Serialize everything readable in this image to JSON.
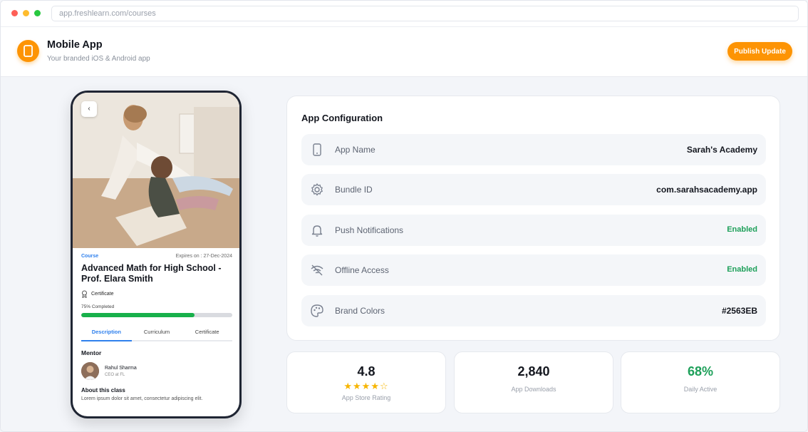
{
  "browser": {
    "url": "app.freshlearn.com/courses"
  },
  "header": {
    "title": "Mobile App",
    "subtitle": "Your branded iOS & Android app",
    "publish_label": "Publish Update"
  },
  "phone": {
    "course_tag": "Course",
    "expires": "Expires on : 27-Dec-2024",
    "course_title": "Advanced Math for High School - Prof. Elara Smith",
    "certificate_label": "Certificate",
    "progress_label": "75% Completed",
    "progress_fraction": 0.75,
    "tabs": [
      {
        "label": "Description",
        "active": true
      },
      {
        "label": "Curriculum",
        "active": false
      },
      {
        "label": "Certificate",
        "active": false
      }
    ],
    "mentor_heading": "Mentor",
    "mentor_name": "Rahul Sharma",
    "mentor_role": "CEO at FL",
    "about_heading": "About this class",
    "about_text": "Lorem ipsum dolor sit amet, consectetur adipiscing elit."
  },
  "config": {
    "title": "App Configuration",
    "rows": [
      {
        "icon": "phone-icon",
        "label": "App Name",
        "value": "Sarah's Academy"
      },
      {
        "icon": "gear-icon",
        "label": "Bundle ID",
        "value": "com.sarahsacademy.app"
      },
      {
        "icon": "bell-icon",
        "label": "Push Notifications",
        "value": "Enabled"
      },
      {
        "icon": "wifi-off-icon",
        "label": "Offline Access",
        "value": "Enabled"
      },
      {
        "icon": "palette-icon",
        "label": "Brand Colors",
        "value": "#2563EB"
      }
    ]
  },
  "stats": [
    {
      "value": "4.8",
      "caption": "App Store Rating",
      "stars": "★★★★☆",
      "rating_out_of_5": 4
    },
    {
      "value": "2,840",
      "caption": "App Downloads"
    },
    {
      "value": "68%",
      "caption": "Daily Active"
    }
  ],
  "colors": {
    "accent": "#FD9404",
    "success": "#1EA05A",
    "link": "#2F80ED",
    "progress": "#18B04B"
  }
}
